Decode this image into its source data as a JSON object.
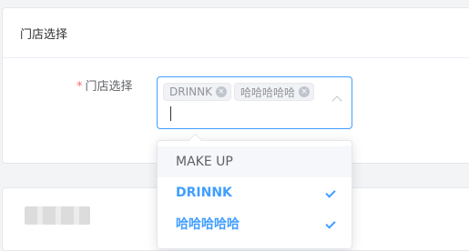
{
  "card": {
    "title": "门店选择"
  },
  "form": {
    "required_mark": "*",
    "label": "门店选择",
    "selected_tags": [
      "DRINNK",
      "哈哈哈哈哈"
    ]
  },
  "dropdown": {
    "options": [
      {
        "label": "MAKE UP",
        "selected": false
      },
      {
        "label": "DRINNK",
        "selected": true
      },
      {
        "label": "哈哈哈哈哈",
        "selected": true
      }
    ]
  },
  "colors": {
    "accent": "#409eff",
    "required": "#f56c6c"
  }
}
